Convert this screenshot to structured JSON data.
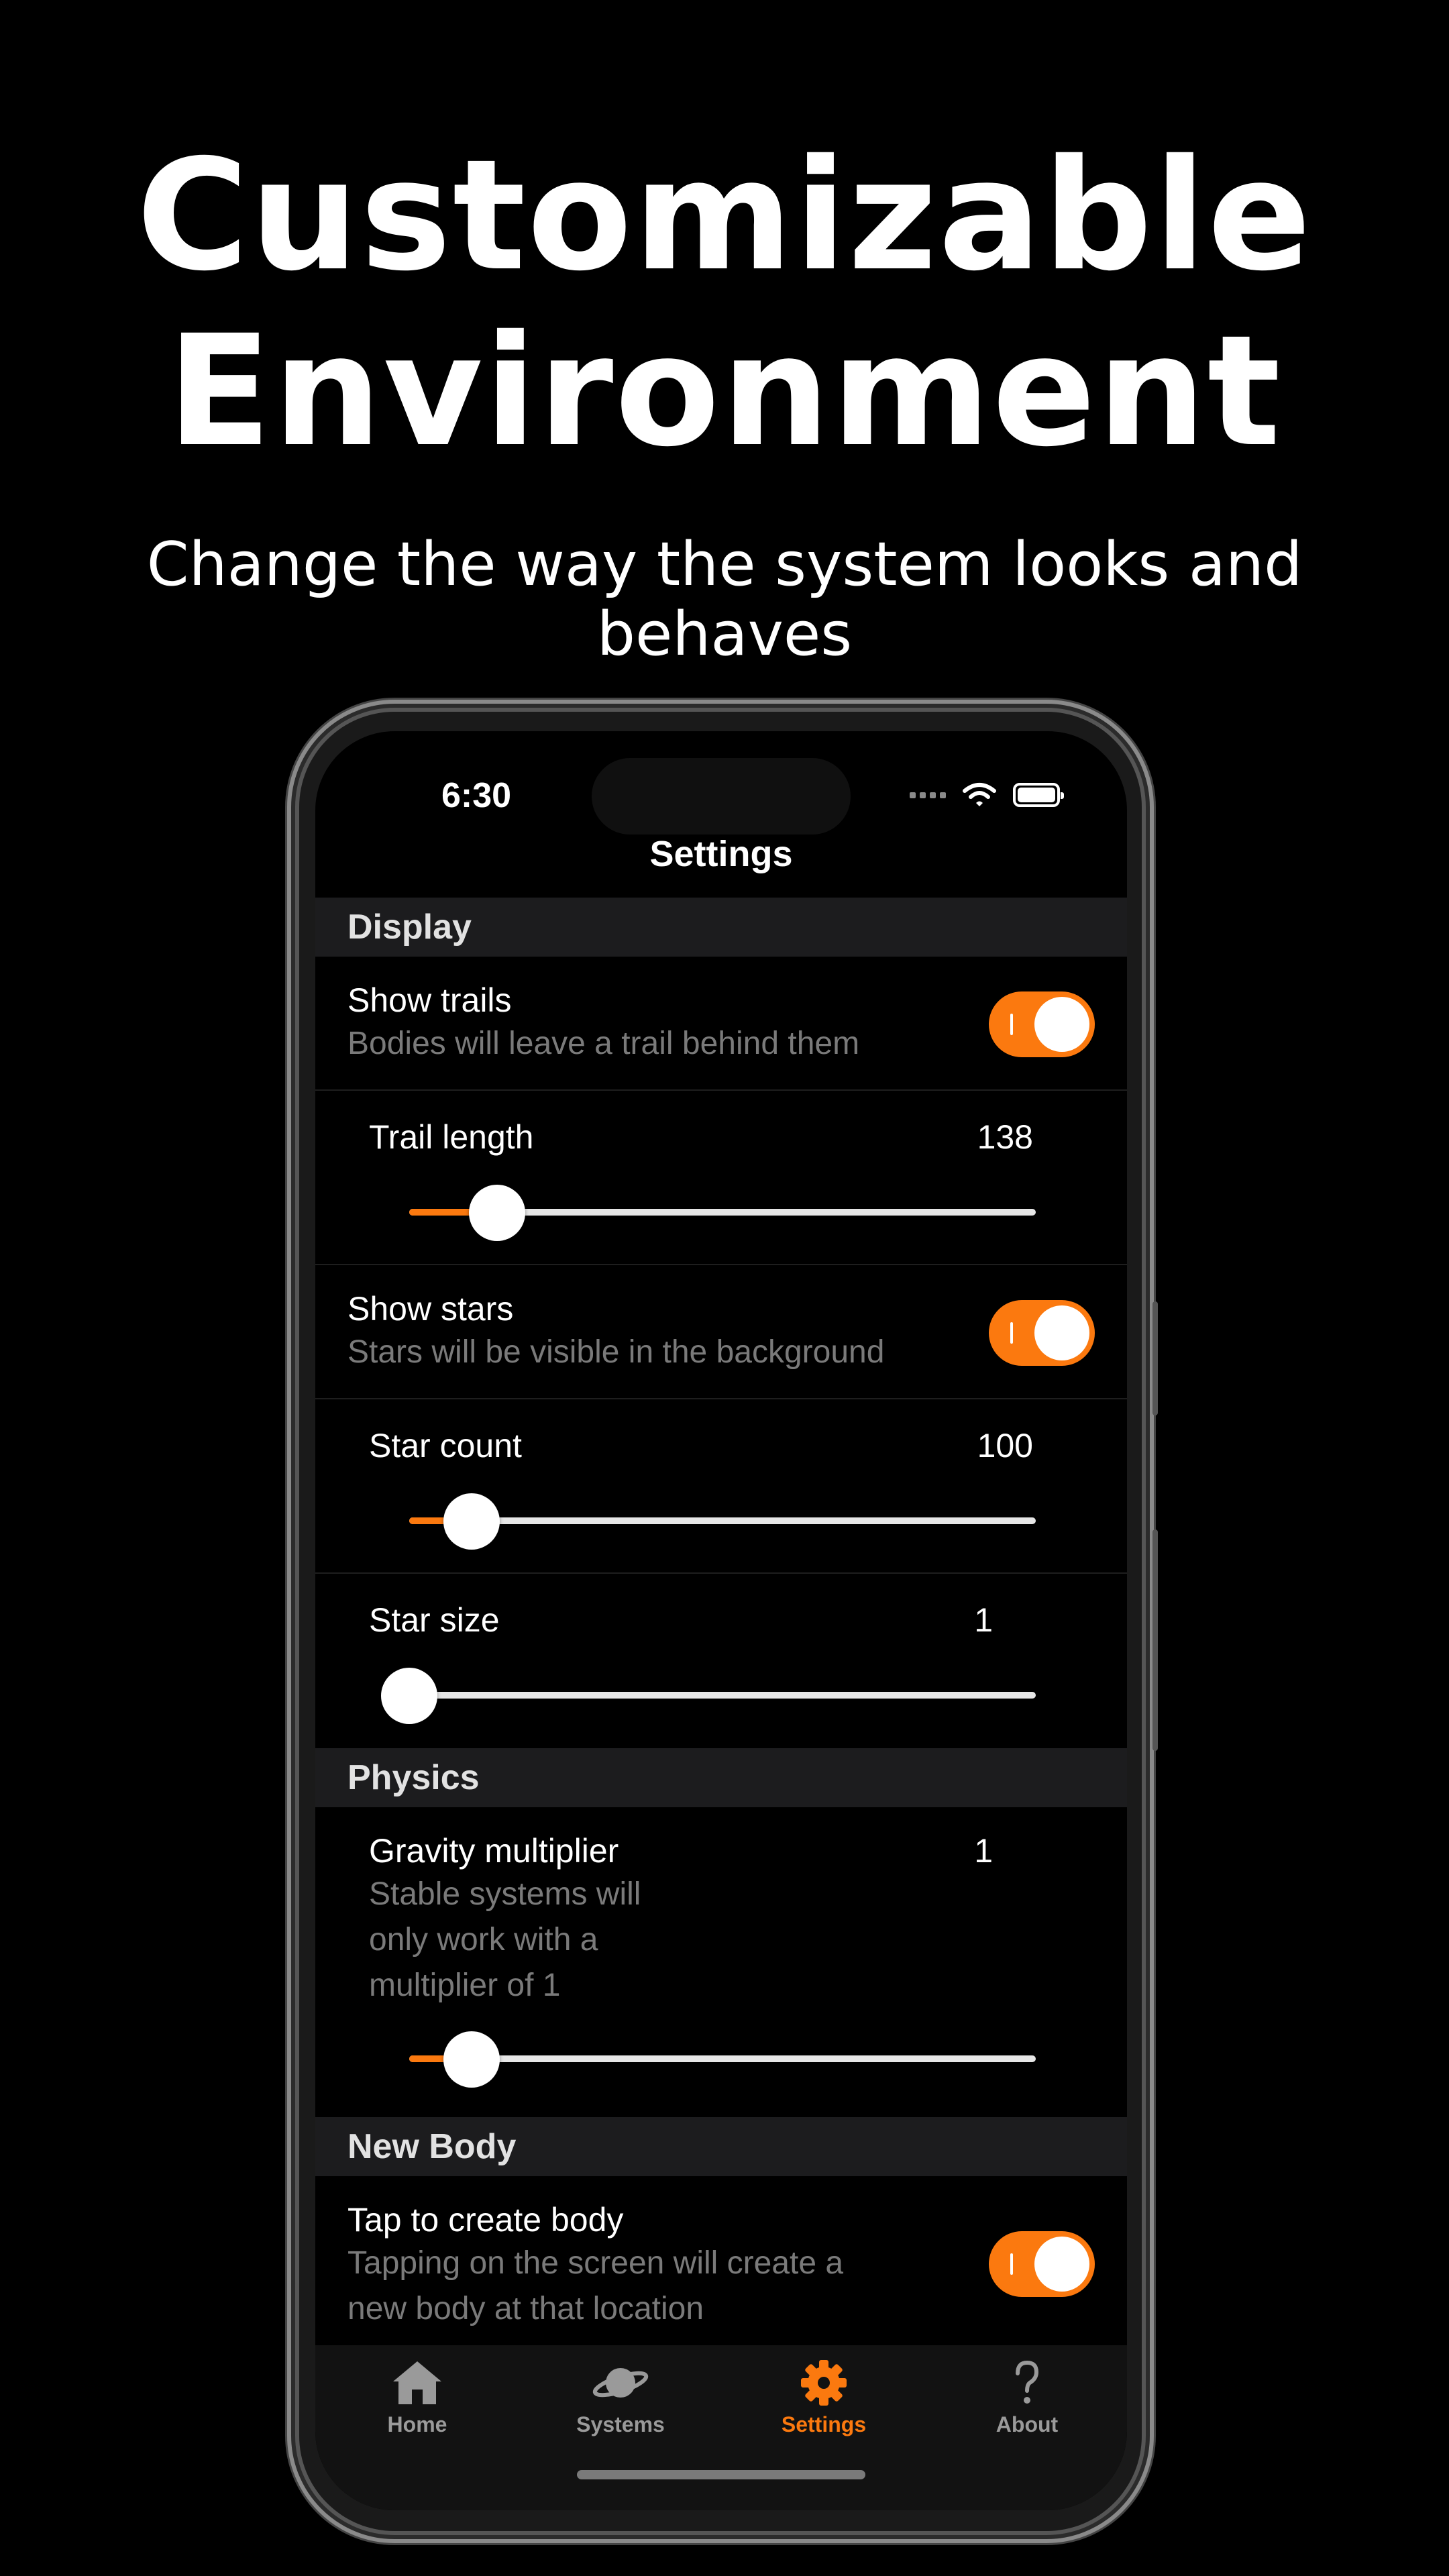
{
  "headline": [
    "Customizable",
    "Environment"
  ],
  "subheadline": [
    "Change the way the system looks and",
    "behaves"
  ],
  "status_bar": {
    "time": "6:30"
  },
  "nav_title": "Settings",
  "accent_color": "#fb790f",
  "sections": {
    "display": {
      "header": "Display",
      "show_trails": {
        "title": "Show trails",
        "subtitle": "Bodies will leave a trail behind them",
        "on": true
      },
      "trail_length": {
        "title": "Trail length",
        "value": "138",
        "fraction": 0.14
      },
      "show_stars": {
        "title": "Show stars",
        "subtitle": "Stars will be visible in the background",
        "on": true
      },
      "star_count": {
        "title": "Star count",
        "value": "100",
        "fraction": 0.1
      },
      "star_size": {
        "title": "Star size",
        "value": "1",
        "fraction": 0.0
      }
    },
    "physics": {
      "header": "Physics",
      "gravity_multiplier": {
        "title": "Gravity multiplier",
        "value": "1",
        "subtitle": [
          "Stable systems will",
          "only work with a",
          "multiplier of 1"
        ],
        "fraction": 0.1
      }
    },
    "new_body": {
      "header": "New Body",
      "tap_to_create": {
        "title": "Tap to create body",
        "subtitle": [
          "Tapping on the screen will create a",
          "new body at that location"
        ],
        "on": true
      }
    }
  },
  "tab_bar": {
    "items": [
      {
        "label": "Home",
        "icon": "house-icon",
        "active": false
      },
      {
        "label": "Systems",
        "icon": "planet-icon",
        "active": false
      },
      {
        "label": "Settings",
        "icon": "gear-icon",
        "active": true
      },
      {
        "label": "About",
        "icon": "question-icon",
        "active": false
      }
    ]
  }
}
